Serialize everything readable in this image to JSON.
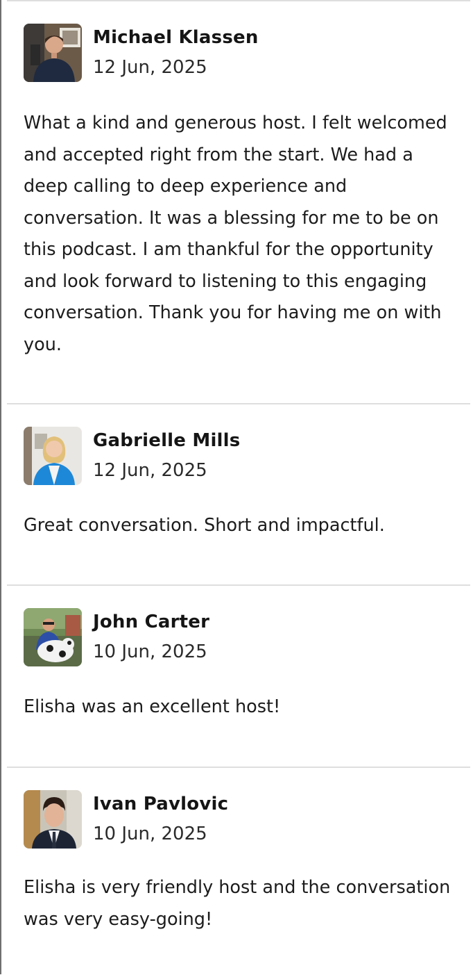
{
  "reviews": [
    {
      "name": "Michael Klassen",
      "date": "12 Jun, 2025",
      "text": "What a kind and generous host. I felt welcomed and accepted right from the start. We had a deep calling to deep experience and conversation. It was a blessing for me to be on this podcast. I am thankful for the opportunity and look forward to listening to this engaging conversation. Thank you for having me on with you."
    },
    {
      "name": "Gabrielle Mills",
      "date": "12 Jun, 2025",
      "text": "Great conversation. Short and impactful."
    },
    {
      "name": "John Carter",
      "date": "10 Jun, 2025",
      "text": "Elisha was an excellent host!"
    },
    {
      "name": "Ivan Pavlovic",
      "date": "10 Jun, 2025",
      "text": "Elisha is very friendly host and the conversation was very easy-going!"
    }
  ]
}
